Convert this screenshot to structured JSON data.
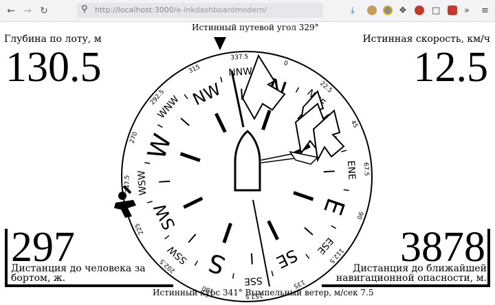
{
  "browser": {
    "url_host": "http://localhost:3000",
    "url_path": "/e-inkdashboardmodern/",
    "back_icon": "arrow-left",
    "forward_icon": "arrow-right",
    "reload_icon": "reload"
  },
  "top": {
    "course_over_ground": "Истинный путевой угол 329°"
  },
  "depth": {
    "label": "Глубина по лоту, м",
    "value": "130.5"
  },
  "speed": {
    "label": "Истинная скорость, км/ч",
    "value": "12.5"
  },
  "mob": {
    "value": "297",
    "label_line1": "Дистанция до человека за",
    "label_line2": "бортом, ж."
  },
  "hazard": {
    "value": "3878",
    "label_line1": "Дистанция до ближайшей",
    "label_line2": "навигационной опасности, м."
  },
  "bottom": {
    "heading_wind": "Истинный курс 341° Вымпельный ветер, м/сек 7.5"
  },
  "compass": {
    "cardinals": [
      "N",
      "E",
      "S",
      "W"
    ],
    "intercardinals": [
      "NE",
      "SE",
      "SW",
      "NW"
    ],
    "minor_points": [
      "NNE",
      "ENE",
      "ESE",
      "SSE",
      "SSW",
      "WSW",
      "WNW",
      "NNW"
    ],
    "degree_labels": [
      "0",
      "22.5",
      "45",
      "67.5",
      "90",
      "112.5",
      "135",
      "157.5",
      "180",
      "202.5",
      "225",
      "247.5",
      "270",
      "292.5",
      "315",
      "337.5"
    ],
    "heading_deg": 341,
    "cog_deg": 329
  }
}
